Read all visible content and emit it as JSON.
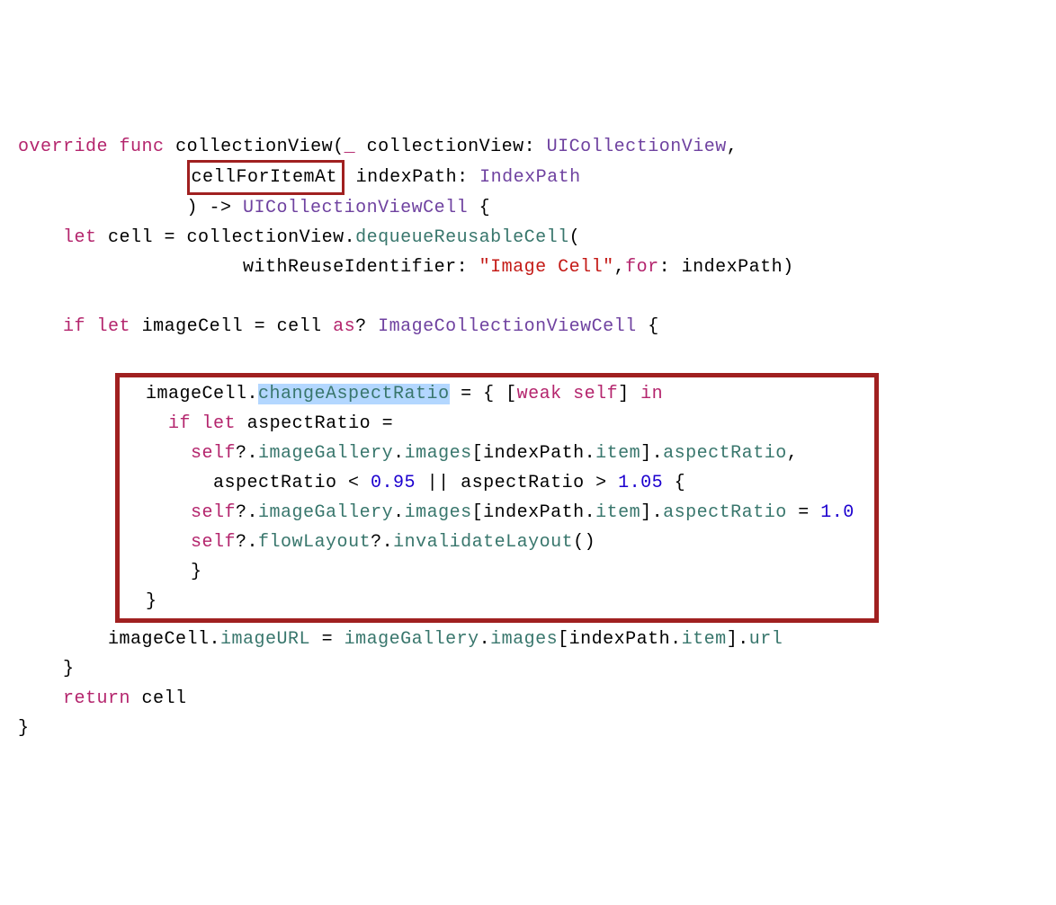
{
  "code": {
    "l1_kw1": "override",
    "l1_kw2": "func",
    "l1_name": "collectionView(",
    "l1_kw3": "_",
    "l1_param": "collectionView:",
    "l1_type": "UICollectionView",
    "l1_comma": ",",
    "l2_box": "cellForItemAt",
    "l2_rest": " indexPath:",
    "l2_type": "IndexPath",
    "l3_a": ") -> ",
    "l3_type": "UICollectionViewCell",
    "l3_b": " {",
    "l4_kw": "let",
    "l4_a": " cell = collectionView.",
    "l4_prop": "dequeueReusableCell",
    "l4_b": "(",
    "l5_a": "withReuseIdentifier: ",
    "l5_str": "\"Image Cell\"",
    "l5_b": ",",
    "l5_kw": "for",
    "l5_c": ": indexPath)",
    "l6_blank": " ",
    "l7_kw1": "if",
    "l7_kw2": "let",
    "l7_a": " imageCell = cell ",
    "l7_kw3": "as",
    "l7_b": "? ",
    "l7_type": "ImageCollectionViewCell",
    "l7_c": " {",
    "l8_a": "  imageCell.",
    "l8_hl": "changeAspectRatio",
    "l8_b": " = { [",
    "l8_kw1": "weak",
    "l8_c": " ",
    "l8_kw2": "self",
    "l8_d": "] ",
    "l8_kw3": "in",
    "l8_pad": "          ",
    "l9_a": "    ",
    "l9_kw1": "if",
    "l9_b": " ",
    "l9_kw2": "let",
    "l9_c": " aspectRatio =",
    "l9_pad": "                                   ",
    "l10_a": "      ",
    "l10_kw": "self",
    "l10_b": "?.",
    "l10_p1": "imageGallery",
    "l10_c": ".",
    "l10_p2": "images",
    "l10_d": "[indexPath.",
    "l10_p3": "item",
    "l10_e": "].",
    "l10_p4": "aspectRatio",
    "l10_f": ",",
    "l11_a": "        aspectRatio < ",
    "l11_n1": "0.95",
    "l11_b": " || aspectRatio > ",
    "l11_n2": "1.05",
    "l11_c": " {",
    "l11_pad": "           ",
    "l12_a": "      ",
    "l12_kw": "self",
    "l12_b": "?.",
    "l12_p1": "imageGallery",
    "l12_c": ".",
    "l12_p2": "images",
    "l12_d": "[indexPath.",
    "l12_p3": "item",
    "l12_e": "].",
    "l12_p4": "aspectRatio",
    "l12_f": " = ",
    "l12_num": "1.0",
    "l13_a": "      ",
    "l13_kw": "self",
    "l13_b": "?.",
    "l13_p1": "flowLayout",
    "l13_c": "?.",
    "l13_p2": "invalidateLayout",
    "l13_d": "()",
    "l13_pad": "                        ",
    "l14_a": "      }",
    "l14_pad": "                                                       ",
    "l15_a": "  }",
    "l15_pad": "                                                           ",
    "l16_a": "imageCell.",
    "l16_p1": "imageURL",
    "l16_b": " = ",
    "l16_p2": "imageGallery",
    "l16_c": ".",
    "l16_p3": "images",
    "l16_d": "[indexPath.",
    "l16_p4": "item",
    "l16_e": "].",
    "l16_p5": "url",
    "l17_a": "}",
    "l18_kw": "return",
    "l18_a": " cell",
    "l19_a": "}"
  }
}
